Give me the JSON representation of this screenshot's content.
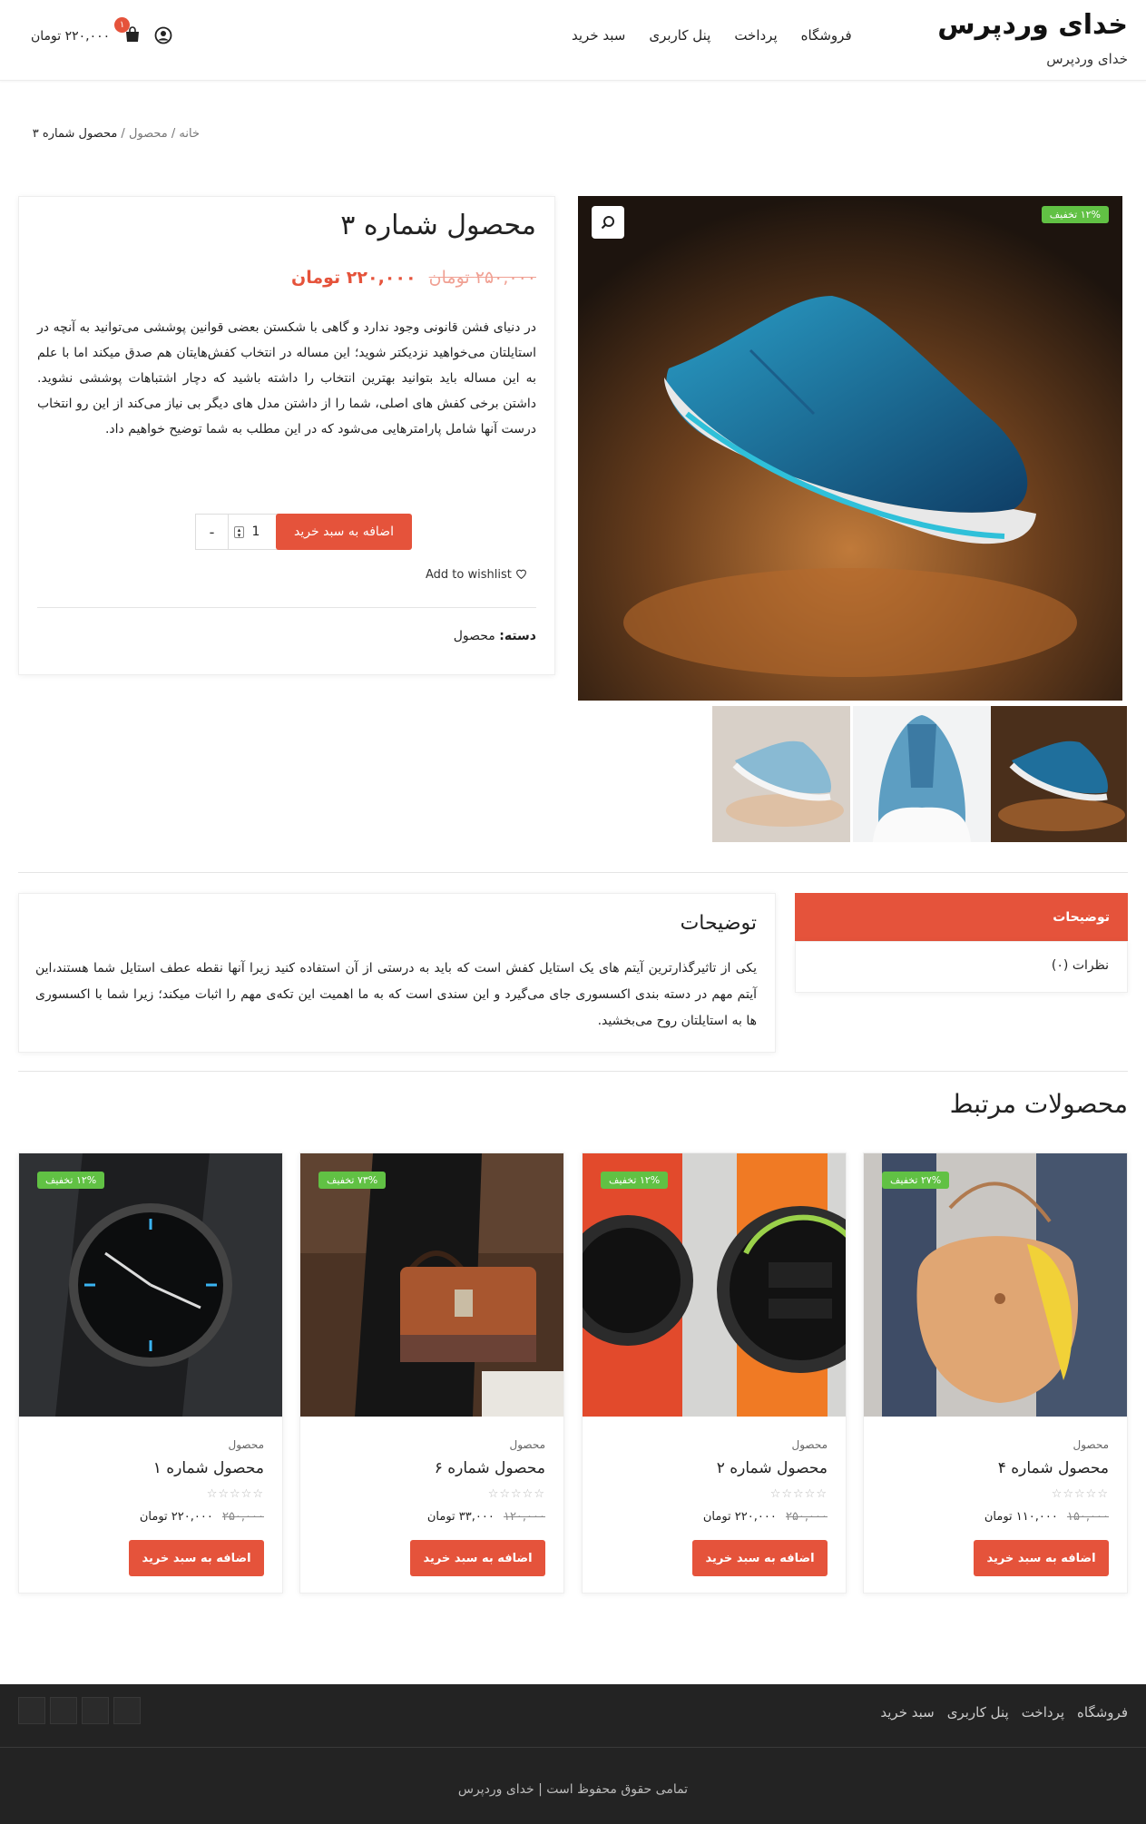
{
  "site": {
    "title": "خدای وردپرس",
    "tagline": "خدای وردپرس"
  },
  "nav": {
    "items": [
      "فروشگاه",
      "پرداخت",
      "پنل کاربری",
      "سبد خرید"
    ]
  },
  "cart": {
    "amount": "۲۲۰,۰۰۰ تومان",
    "count": "۱"
  },
  "breadcrumb": {
    "home": "خانه",
    "sep1": " / ",
    "category": "محصول",
    "sep2": " / ",
    "current": "محصول شماره ۳"
  },
  "product": {
    "title": "محصول شماره ۳",
    "old_price": "۲۵۰,۰۰۰ تومان",
    "new_price": "۲۲۰,۰۰۰ تومان",
    "description": "در دنیای فشن قانونی وجود ندارد و گاهی با شکستن بعضی قوانین پوششی می‌توانید به آنچه در استایلتان می‌خواهید نزدیکتر شوید؛ این مساله در انتخاب کفش‌هایتان هم صدق میکند اما با علم به این مساله باید بتوانید بهترین انتخاب را داشته باشید که دچار اشتباهات پوششی نشوید. داشتن برخی کفش های اصلی، شما را از داشتن مدل های دیگر بی نیاز می‌کند از این رو انتخاب درست آنها شامل پارامترهایی می‌شود که در این مطلب به شما توضیح خواهیم داد.",
    "quantity": "1",
    "qty_plus": "+",
    "qty_minus": "-",
    "add_to_cart": "اضافه به سبد خرید",
    "wishlist": "Add to wishlist",
    "category_label": "دسته:",
    "category_value": "محصول",
    "discount_badge": "۱۲% تخفیف"
  },
  "tabs": {
    "description": "توضیحات",
    "reviews": "نظرات (۰)"
  },
  "description_section": {
    "title": "توضیحات",
    "body": "یکی از تاثیرگذارترین آیتم های یک استایل کفش است که باید به درستی از آن استفاده کنید زیرا آنها نقطه عطف استایل شما هستند،این آیتم مهم در دسته بندی اکسسوری جای می‌گیرد و این سندی است که به ما اهمیت این تکه‌ی مهم را اثبات میکند؛ زیرا شما با اکسسوری ها به استایلتان روح می‌بخشید."
  },
  "related": {
    "title": "محصولات مرتبط",
    "products": [
      {
        "category": "محصول",
        "name": "محصول شماره ۴",
        "old_price": "۱۵۰,۰۰۰",
        "new_price": "۱۱۰,۰۰۰ تومان",
        "badge": "۲۷% تخفیف",
        "button": "اضافه به سبد خرید",
        "image": "bag-icon"
      },
      {
        "category": "محصول",
        "name": "محصول شماره ۲",
        "old_price": "۲۵۰,۰۰۰",
        "new_price": "۲۲۰,۰۰۰ تومان",
        "badge": "۱۲% تخفیف",
        "button": "اضافه به سبد خرید",
        "image": "smartwatch-icon"
      },
      {
        "category": "محصول",
        "name": "محصول شماره ۶",
        "old_price": "۱۲۰,۰۰۰",
        "new_price": "۳۳,۰۰۰ تومان",
        "badge": "۷۳% تخفیف",
        "button": "اضافه به سبد خرید",
        "image": "handbag-icon"
      },
      {
        "category": "محصول",
        "name": "محصول شماره ۱",
        "old_price": "۲۵۰,۰۰۰",
        "new_price": "۲۲۰,۰۰۰ تومان",
        "badge": "۱۲% تخفیف",
        "button": "اضافه به سبد خرید",
        "image": "wristwatch-icon"
      }
    ],
    "stars": "☆☆☆☆☆"
  },
  "footer": {
    "nav": [
      "فروشگاه",
      "پرداخت",
      "پنل کاربری",
      "سبد خرید"
    ],
    "copyright": "تمامی حقوق محفوظ است | خدای وردپرس"
  },
  "colors": {
    "accent": "#e5533b",
    "badge": "#61c144",
    "footer_bg": "#232323"
  }
}
